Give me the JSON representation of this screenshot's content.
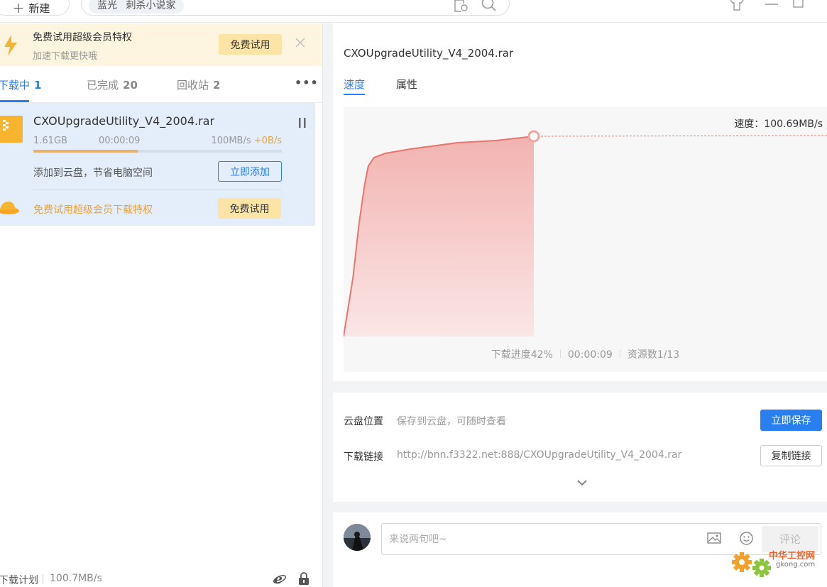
{
  "toolbar": {
    "new_label": "新建",
    "search_tag": "蓝光 刺杀小说家"
  },
  "promo": {
    "title": "免费试用超级会员特权",
    "subtitle": "加速下载更快哦",
    "button": "免费试用"
  },
  "tabs": [
    {
      "label": "下载中",
      "count": "1"
    },
    {
      "label": "已完成",
      "count": "20"
    },
    {
      "label": "回收站",
      "count": "2"
    }
  ],
  "more_label": "•••",
  "download_item": {
    "name": "CXOUpgradeUtility_V4_2004.rar",
    "size": "1.61GB",
    "elapsed": "00:00:09",
    "speed": "100MB/s",
    "extra_speed": "+0B/s",
    "progress": 0.42,
    "cloud_hint": "添加到云盘，节省电脑空间",
    "add_button": "立即添加",
    "vip_text": "免费试用超级会员下载特权",
    "vip_button": "免费试用"
  },
  "statusbar": {
    "plan": "下载计划",
    "speed": "100.7MB/s"
  },
  "detail": {
    "title": "CXOUpgradeUtility_V4_2004.rar",
    "tabs": [
      "速度",
      "属性"
    ],
    "speed_label": "速度：100.69MB/s",
    "stats": {
      "progress": "下载进度42%",
      "elapsed": "00:00:09",
      "sources": "资源数1/13"
    }
  },
  "chart_data": {
    "type": "area",
    "x": [
      0,
      0.05,
      0.08,
      0.11,
      0.13,
      0.16,
      0.22,
      0.35,
      0.6,
      0.8,
      1.0
    ],
    "values": [
      0,
      0.28,
      0.52,
      0.71,
      0.8,
      0.84,
      0.86,
      0.88,
      0.91,
      0.92,
      0.94
    ],
    "series_color": "#e8756e",
    "fill_color": "#f4bcbc",
    "xlabel": "",
    "ylabel": ""
  },
  "info": {
    "cloud_label": "云盘位置",
    "cloud_value": "保存到云盘，可随时查看",
    "save_button": "立即保存",
    "link_label": "下载链接",
    "link_value": "http://bnn.f3322.net:888/CXOUpgradeUtility_V4_2004.rar",
    "copy_button": "复制链接"
  },
  "comment": {
    "placeholder": "来说两句吧~",
    "button": "评论"
  },
  "watermark": {
    "text": "中华工控网",
    "url": "gkong.com"
  },
  "colors": {
    "accent": "#2a7ff0",
    "vip_gold": "#e8a43a",
    "chart_line": "#e8756e"
  }
}
